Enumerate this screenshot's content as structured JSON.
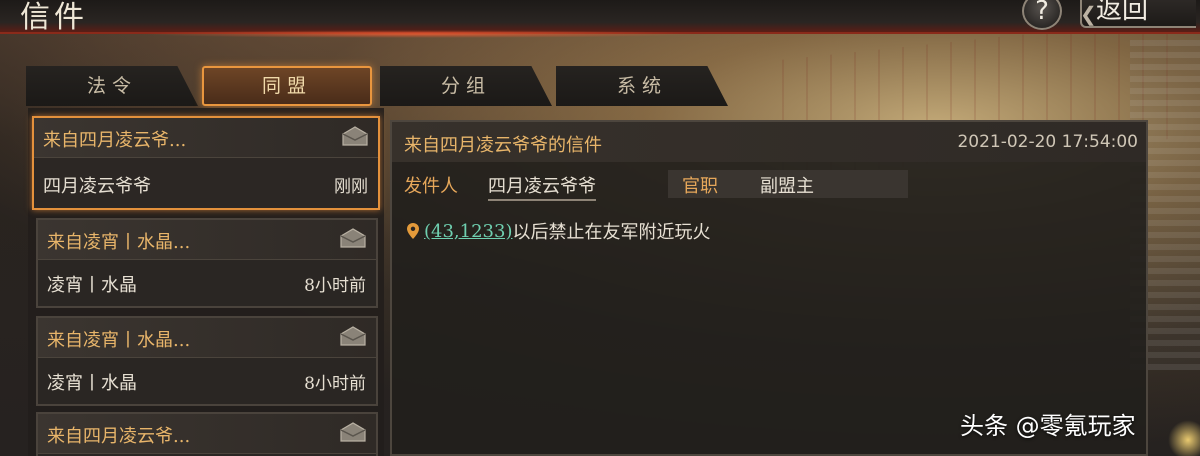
{
  "header": {
    "title": "信件",
    "help_label": "?",
    "back_label": "返回"
  },
  "tabs": [
    {
      "label": "法令",
      "active": false
    },
    {
      "label": "同盟",
      "active": true
    },
    {
      "label": "分组",
      "active": false
    },
    {
      "label": "系统",
      "active": false
    }
  ],
  "mail_list": [
    {
      "from": "来自四月凌云爷...",
      "sender": "四月凌云爷爷",
      "time": "刚刚",
      "selected": true
    },
    {
      "from": "来自凌宵丨水晶...",
      "sender": "凌宵丨水晶",
      "time": "8小时前",
      "selected": false
    },
    {
      "from": "来自凌宵丨水晶...",
      "sender": "凌宵丨水晶",
      "time": "8小时前",
      "selected": false
    },
    {
      "from": "来自四月凌云爷...",
      "sender": "",
      "time": "",
      "selected": false
    }
  ],
  "detail": {
    "title": "来自四月凌云爷爷的信件",
    "date": "2021-02-20 17:54:00",
    "sender_label": "发件人",
    "sender_value": "四月凌云爷爷",
    "position_label": "官职",
    "position_value": "副盟主",
    "coord_link": "(43,1233)",
    "message": "以后禁止在友军附近玩火"
  },
  "watermark": "头条 @零氪玩家",
  "colors": {
    "accent_orange": "#e4913c",
    "gold_text": "#e8b56a",
    "link_teal": "#6fd0b0"
  }
}
